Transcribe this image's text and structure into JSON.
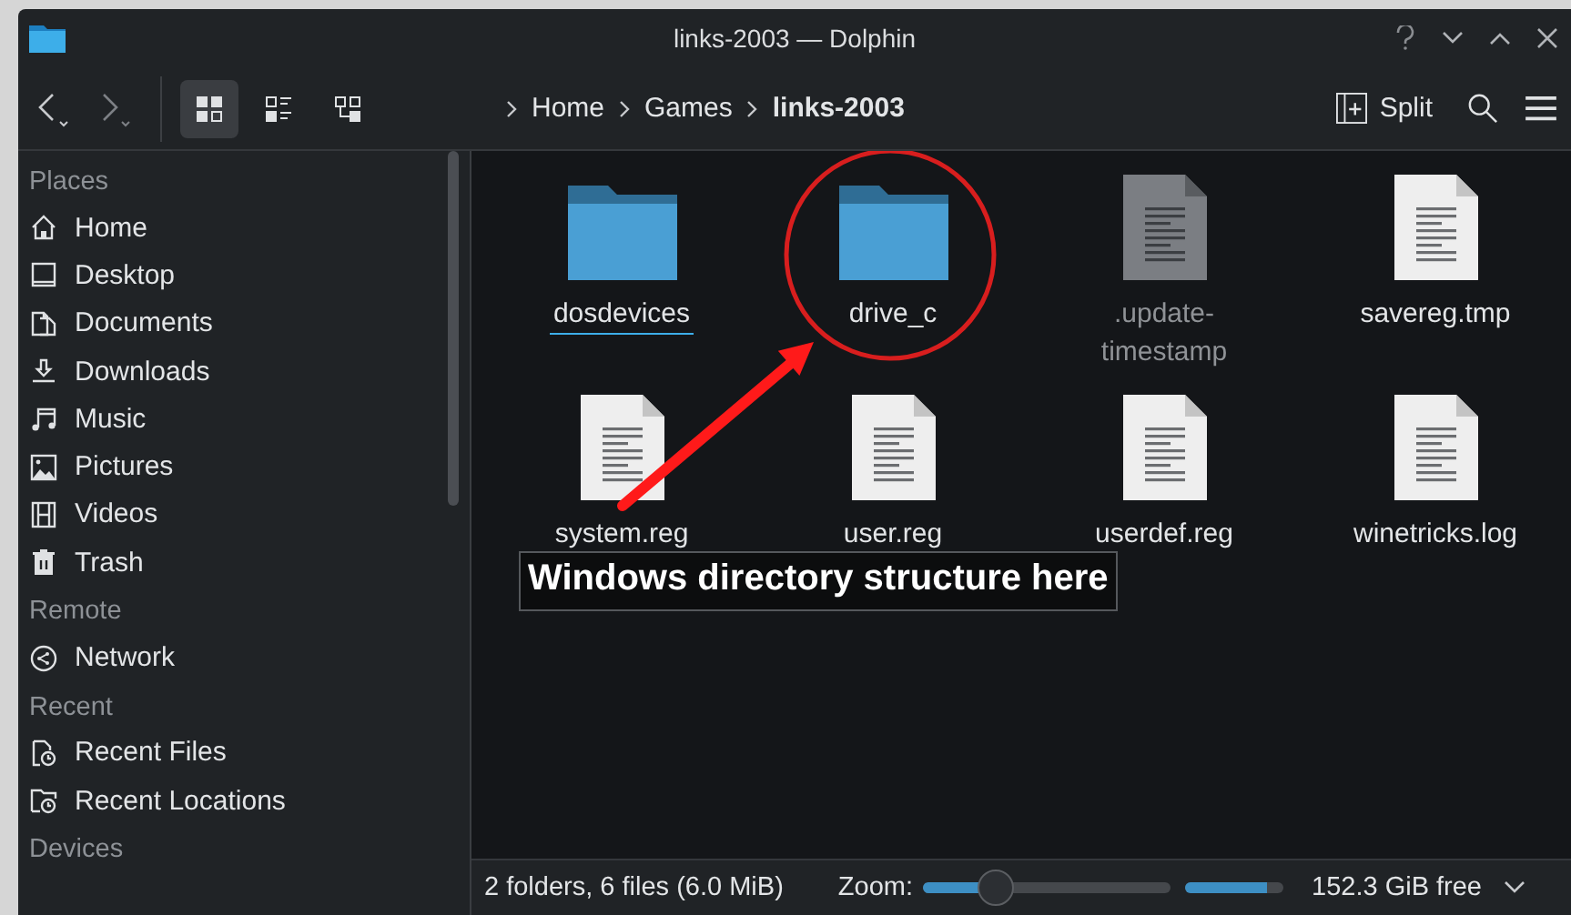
{
  "window": {
    "title": "links-2003 — Dolphin"
  },
  "toolbar": {
    "view_modes": [
      {
        "selected": true
      },
      {
        "selected": false
      },
      {
        "selected": false
      }
    ],
    "split": "Split"
  },
  "breadcrumb": [
    {
      "label": "Home",
      "current": false
    },
    {
      "label": "Games",
      "current": false
    },
    {
      "label": "links-2003",
      "current": true
    }
  ],
  "sidebar": {
    "sections": [
      {
        "title": "Places",
        "items": [
          {
            "label": "Home"
          },
          {
            "label": "Desktop"
          },
          {
            "label": "Documents"
          },
          {
            "label": "Downloads"
          },
          {
            "label": "Music"
          },
          {
            "label": "Pictures"
          },
          {
            "label": "Videos"
          },
          {
            "label": "Trash"
          }
        ]
      },
      {
        "title": "Remote",
        "items": [
          {
            "label": "Network"
          }
        ]
      },
      {
        "title": "Recent",
        "items": [
          {
            "label": "Recent Files"
          },
          {
            "label": "Recent Locations"
          }
        ]
      },
      {
        "title": "Devices"
      }
    ]
  },
  "files": [
    {
      "name": "dosdevices",
      "kind": "folder",
      "hidden": false,
      "focused": true
    },
    {
      "name": "drive_c",
      "kind": "folder",
      "hidden": false,
      "focused": false
    },
    {
      "name": ".update-timestamp",
      "kind": "text",
      "hidden": true,
      "focused": false
    },
    {
      "name": "savereg.tmp",
      "kind": "text",
      "hidden": false,
      "focused": false
    },
    {
      "name": "system.reg",
      "kind": "text",
      "hidden": false,
      "focused": false
    },
    {
      "name": "user.reg",
      "kind": "text",
      "hidden": false,
      "focused": false
    },
    {
      "name": "userdef.reg",
      "kind": "text",
      "hidden": false,
      "focused": false
    },
    {
      "name": "winetricks.log",
      "kind": "text",
      "hidden": false,
      "focused": false
    }
  ],
  "annotation": {
    "text": "Windows directory structure here"
  },
  "status_bar": {
    "summary": "2 folders, 6 files (6.0 MiB)",
    "zoom_label": "Zoom:",
    "zoom": {
      "level": 0.3
    },
    "space": {
      "level": 0.85
    },
    "free": "152.3 GiB free"
  }
}
